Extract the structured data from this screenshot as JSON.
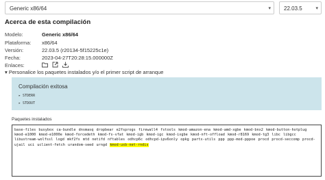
{
  "selects": {
    "target": "Generic x86/64",
    "version": "22.03.5"
  },
  "section_title": "Acerca de esta compilación",
  "info": {
    "model_label": "Modelo:",
    "model": "Generic x86/64",
    "platform_label": "Plataforma:",
    "platform": "x86/64",
    "version_label": "Versión:",
    "version": "22.03.5 (r20134-5f15225c1e)",
    "date_label": "Fecha:",
    "date": "2023-04-27T20:28:15.000000Z",
    "links_label": "Enlaces:"
  },
  "personalize": "▾ Personalice los paquetes instalados y/o el primer script de arranque",
  "panel": {
    "status": "Compilación exitosa",
    "stderr": "▸ STDERR",
    "stdout": "▸ STDOUT"
  },
  "packages_label": "Paquetes instalados",
  "packages_text": "base-files busybox ca-bundle dnsmasq dropbear e2fsprogs firewall4 fstools kmod-amazon-ena kmod-amd-xgbe kmod-bnx2 kmod-button-hotplug kmod-e1000 kmod-e1000e kmod-forcedeth kmod-fs-vfat kmod-igb kmod-igc kmod-ixgbe kmod-nft-offload kmod-r8169 kmod-tg3 libc libgcc libustream-wolfssl logd mkf2fs mtd netifd nftables odhcp6c odhcpd-ipv6only opkg partx-utils ppp ppp-mod-pppoe procd procd-seccomp procd-ujail uci uclient-fetch urandom-seed urngd",
  "packages_highlight": "kmod-usb-net-rndis"
}
